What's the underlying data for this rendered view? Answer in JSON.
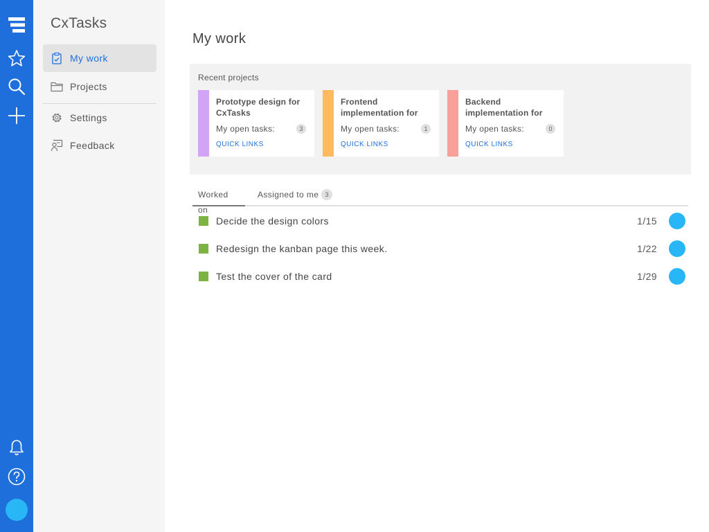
{
  "app": {
    "title": "CxTasks"
  },
  "rail": {
    "icons": [
      "menu-icon",
      "star-icon",
      "search-icon",
      "plus-icon",
      "bell-icon",
      "help-icon"
    ],
    "color": "#1e6fdc",
    "avatar_color": "#29b6f6"
  },
  "nav": {
    "items": [
      {
        "label": "My work",
        "icon": "clipboard-icon",
        "active": true
      },
      {
        "label": "Projects",
        "icon": "folder-icon",
        "active": false
      },
      {
        "label": "Settings",
        "icon": "gear-icon",
        "active": false
      },
      {
        "label": "Feedback",
        "icon": "feedback-icon",
        "active": false
      }
    ]
  },
  "main": {
    "title": "My work",
    "recent": {
      "label": "Recent projects",
      "cards": [
        {
          "name": "Prototype design for CxTasks",
          "open_label": "My open tasks:",
          "count": "3",
          "links": "QUICK LINKS",
          "color": "#d3a4f5"
        },
        {
          "name": "Frontend implementation for",
          "open_label": "My open tasks:",
          "count": "1",
          "links": "QUICK LINKS",
          "color": "#ffb95e"
        },
        {
          "name": "Backend implementation for",
          "open_label": "My open tasks:",
          "count": "0",
          "links": "QUICK LINKS",
          "color": "#f9a09a"
        }
      ]
    },
    "tabs": [
      {
        "label": "Worked on",
        "active": true
      },
      {
        "label": "Assigned to me",
        "badge": "3",
        "active": false
      }
    ],
    "tasks": [
      {
        "title": "Decide the design colors",
        "date": "1/15"
      },
      {
        "title": "Redesign the kanban page this week.",
        "date": "1/22"
      },
      {
        "title": "Test the cover of the card",
        "date": "1/29"
      }
    ],
    "task_color": "#7cb342"
  }
}
